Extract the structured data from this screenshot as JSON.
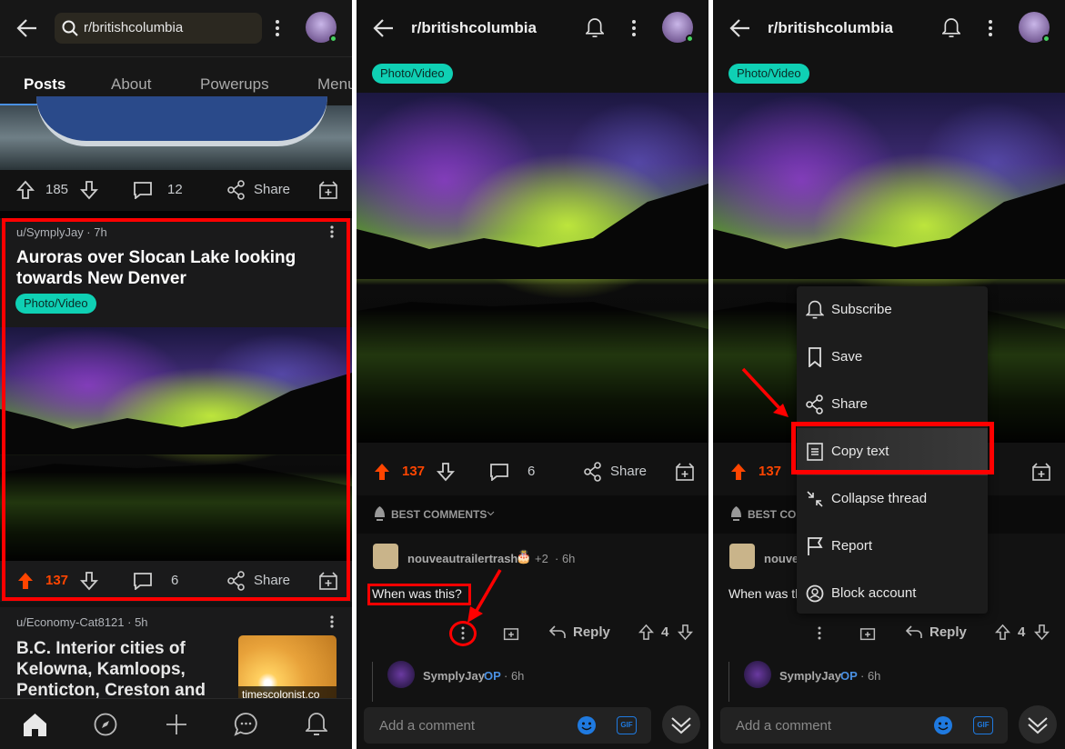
{
  "panel1": {
    "search": {
      "value": "r/britishcolumbia"
    },
    "tabs": [
      {
        "label": "Posts",
        "active": true
      },
      {
        "label": "About"
      },
      {
        "label": "Powerups"
      },
      {
        "label": "Menu"
      }
    ],
    "prev_post": {
      "upvotes": "185",
      "comments": "12",
      "share": "Share"
    },
    "post": {
      "author": "u/SymplyJay · 7h",
      "title": "Auroras over Slocan Lake looking towards New Denver",
      "flair": "Photo/Video",
      "upvotes": "137",
      "comments": "6",
      "share": "Share"
    },
    "next_post": {
      "author": "u/Economy-Cat8121 · 5h",
      "title": "B.C. Interior cities of Kelowna, Kamloops, Penticton, Creston and",
      "thumb_caption": "timescolonist.co"
    },
    "bottom_nav": [
      "home-icon",
      "compass-icon",
      "plus-icon",
      "chat-icon",
      "bell-icon"
    ]
  },
  "detail": {
    "title": "r/britishcolumbia",
    "flair": "Photo/Video",
    "upvotes": "137",
    "comments": "6",
    "share": "Share",
    "sort_label": "BEST COMMENTS",
    "comment": {
      "author": "nouveautrailertrash",
      "karma": "+2",
      "time": "· 6h",
      "text": "When was this?",
      "reply": "Reply",
      "score": "4"
    },
    "reply_comment": {
      "author": "SymplyJay",
      "badge": "OP",
      "time": "· 6h"
    },
    "input": {
      "placeholder": "Add a comment",
      "gif": "GIF"
    }
  },
  "menu": {
    "items": [
      {
        "label": "Subscribe",
        "icon": "bell-icon"
      },
      {
        "label": "Save",
        "icon": "bookmark-icon"
      },
      {
        "label": "Share",
        "icon": "share-icon"
      },
      {
        "label": "Copy text",
        "icon": "copy-text-icon"
      },
      {
        "label": "Collapse thread",
        "icon": "collapse-icon"
      },
      {
        "label": "Report",
        "icon": "flag-icon"
      },
      {
        "label": "Block account",
        "icon": "block-icon"
      }
    ]
  },
  "colors": {
    "upvote": "#ff4500",
    "flair": "#0fd0b4",
    "highlight": "#ff0000",
    "op": "#4a90e2",
    "background": "#121212"
  }
}
